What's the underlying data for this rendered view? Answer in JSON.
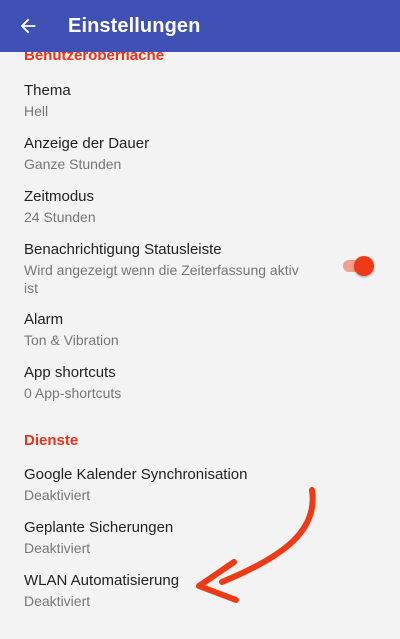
{
  "appbar": {
    "title": "Einstellungen",
    "back_icon": "arrow-left-icon"
  },
  "sections": {
    "ui": {
      "header": "Benutzeroberfläche",
      "items": [
        {
          "title": "Thema",
          "summary": "Hell"
        },
        {
          "title": "Anzeige der Dauer",
          "summary": "Ganze Stunden"
        },
        {
          "title": "Zeitmodus",
          "summary": "24 Stunden"
        },
        {
          "title": "Benachrichtigung Statusleiste",
          "summary": "Wird angezeigt wenn die Zeiterfassung aktiv ist",
          "switch_on": true
        },
        {
          "title": "Alarm",
          "summary": "Ton & Vibration"
        },
        {
          "title": "App shortcuts",
          "summary": "0 App-shortcuts"
        }
      ]
    },
    "services": {
      "header": "Dienste",
      "items": [
        {
          "title": "Google Kalender Synchronisation",
          "summary": "Deaktiviert"
        },
        {
          "title": "Geplante Sicherungen",
          "summary": "Deaktiviert"
        },
        {
          "title": "WLAN Automatisierung",
          "summary": "Deaktiviert"
        }
      ]
    }
  },
  "colors": {
    "appbar": "#3f51b5",
    "accent": "#e8321a",
    "annotation_arrow": "#f03a16"
  }
}
